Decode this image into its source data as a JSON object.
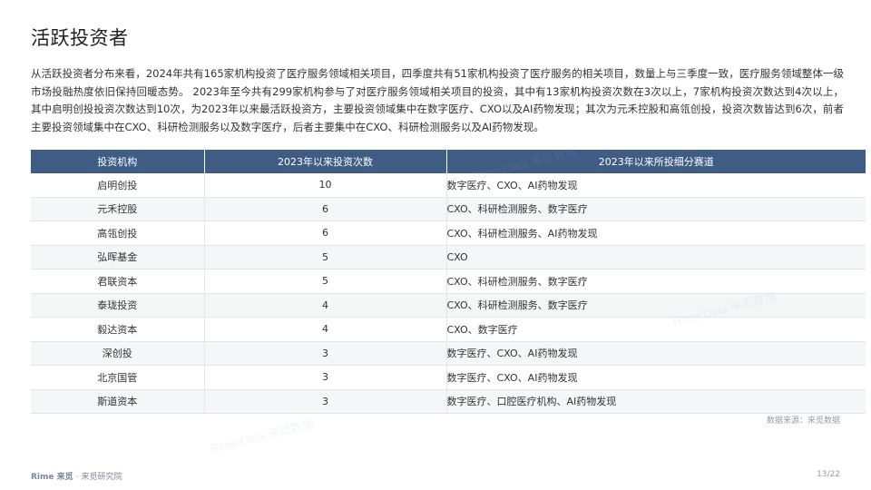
{
  "title": "活跃投资者",
  "intro": "从活跃投资者分布来看，2024年共有165家机构投资了医疗服务领域相关项目，四季度共有51家机构投资了医疗服务的相关项目，数量上与三季度一致，医疗服务领域整体一级市场投融热度依旧保持回暖态势。 2023年至今共有299家机构参与了对医疗服务领域相关项目的投资，其中有13家机构投资次数在3次以上，7家机构投资次数达到4次以上，其中启明创投投资次数达到10次，为2023年以来最活跃投资方，主要投资领域集中在数字医疗、CXO以及AI药物发现；其次为元禾控股和高瓴创投，投资次数皆达到6次，前者主要投资领域集中在CXO、科研检测服务以及数字医疗，后者主要集中在CXO、科研检测服务以及AI药物发现。",
  "table": {
    "headers": [
      "投资机构",
      "2023年以来投资次数",
      "2023年以来所投细分赛道"
    ],
    "rows": [
      {
        "org": "启明创投",
        "count": "10",
        "tracks": "数字医疗、CXO、AI药物发现"
      },
      {
        "org": "元禾控股",
        "count": "6",
        "tracks": "CXO、科研检测服务、数字医疗"
      },
      {
        "org": "高瓴创投",
        "count": "6",
        "tracks": "CXO、科研检测服务、AI药物发现"
      },
      {
        "org": "弘晖基金",
        "count": "5",
        "tracks": "CXO"
      },
      {
        "org": "君联资本",
        "count": "5",
        "tracks": "CXO、科研检测服务、数字医疗"
      },
      {
        "org": "泰珑投资",
        "count": "4",
        "tracks": "CXO、科研检测服务、数字医疗"
      },
      {
        "org": "毅达资本",
        "count": "4",
        "tracks": "CXO、数字医疗"
      },
      {
        "org": "深创投",
        "count": "3",
        "tracks": "数字医疗、CXO、AI药物发现"
      },
      {
        "org": "北京国管",
        "count": "3",
        "tracks": "数字医疗、CXO、AI药物发现"
      },
      {
        "org": "斯道资本",
        "count": "3",
        "tracks": "数字医疗、口腔医疗机构、AI药物发现"
      }
    ]
  },
  "source": "数据来源：来觅数据",
  "footer": {
    "brand": "Rime 来觅",
    "org": "· 来觅研究院"
  },
  "page_number": "13/22",
  "watermark": "Rime Data 来觅数据"
}
